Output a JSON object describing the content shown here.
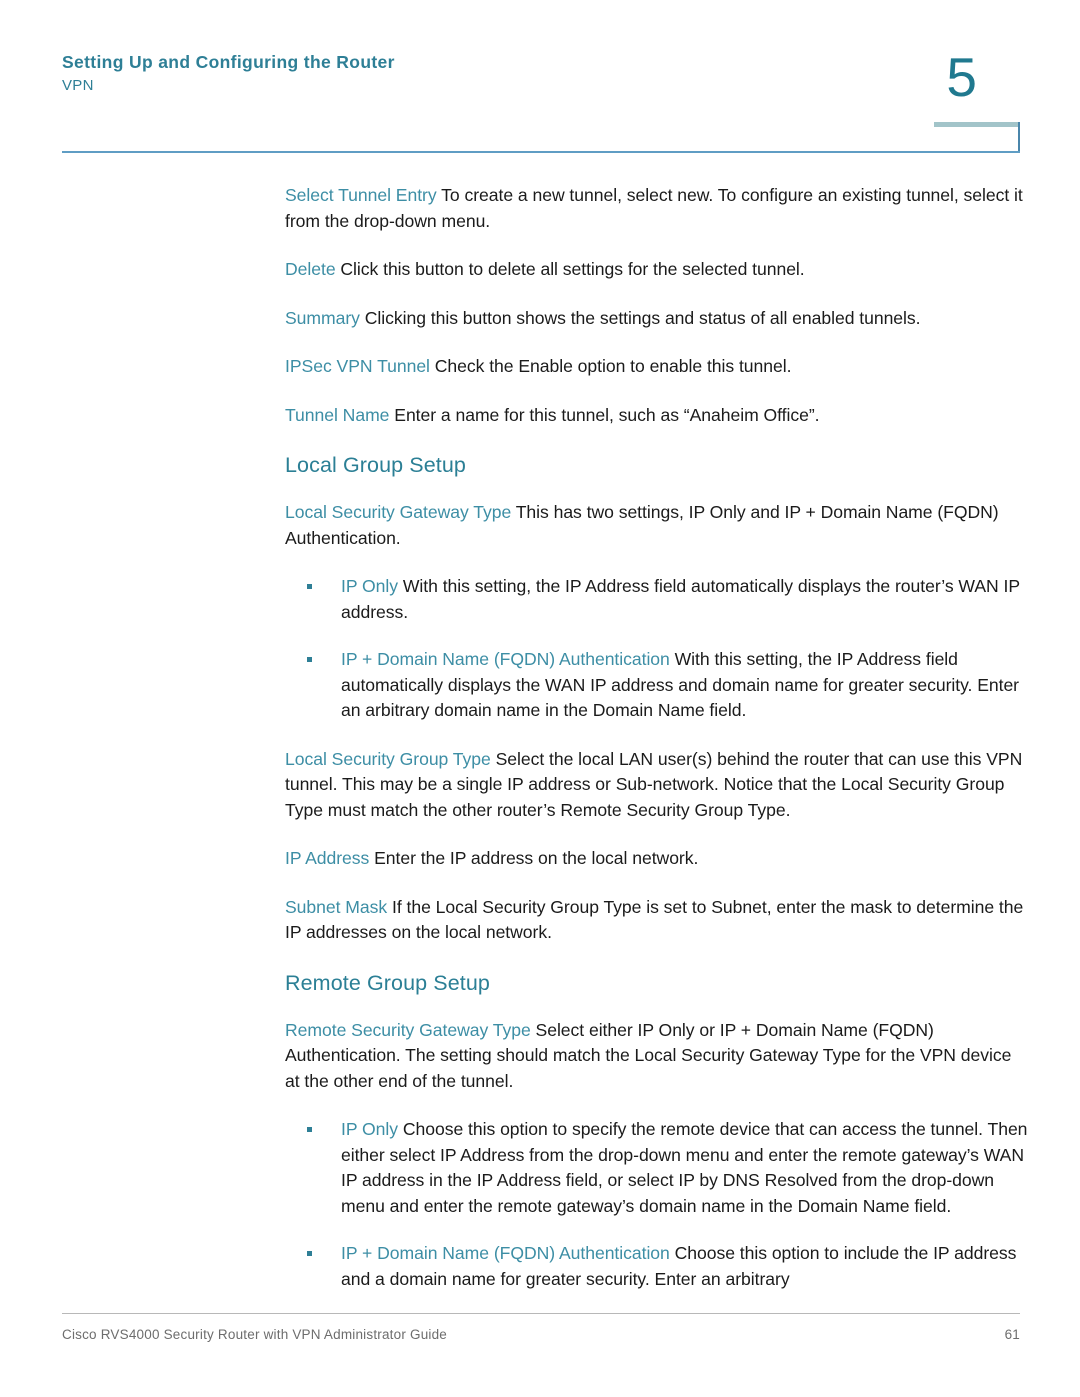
{
  "header": {
    "title": "Setting Up and Configuring the Router",
    "subtitle": "VPN",
    "chapter_number": "5",
    "accent_color": "#2e7f96",
    "rule_color": "#5f9dc4"
  },
  "content": {
    "paragraphs": [
      {
        "term": "Select Tunnel Entry",
        "text": " To create a new tunnel, select new. To configure an existing tunnel, select it from the drop-down menu."
      },
      {
        "term": "Delete",
        "text": " Click this button to delete all settings for the selected tunnel."
      },
      {
        "term": "Summary",
        "text": " Clicking this button shows the settings and status of all enabled tunnels."
      },
      {
        "term": "IPSec VPN Tunnel",
        "text": " Check the Enable option to enable this tunnel."
      },
      {
        "term": "Tunnel Name",
        "text": " Enter a name for this tunnel, such as “Anaheim Office”."
      }
    ],
    "section_local": {
      "heading": "Local Group Setup",
      "gateway_type": {
        "term": "Local Security Gateway Type",
        "text": " This has two settings, IP Only and IP + Domain Name (FQDN) Authentication."
      },
      "bullets": [
        {
          "term": "IP Only",
          "text": " With this setting, the IP Address field automatically displays the router’s WAN IP address."
        },
        {
          "term": "IP + Domain Name (FQDN) Authentication",
          "text": " With this setting, the IP Address field automatically displays the WAN IP address and domain name for greater security. Enter an arbitrary domain name in the Domain Name field."
        }
      ],
      "group_type": {
        "term": "Local Security Group Type",
        "text": " Select the local LAN user(s) behind the router that can use this VPN tunnel. This may be a single IP address or Sub-network. Notice that the Local Security Group Type must match the other router’s Remote Security Group Type."
      },
      "ip_address": {
        "term": "IP Address",
        "text": " Enter the IP address on the local network."
      },
      "subnet_mask": {
        "term": "Subnet Mask",
        "text": " If the Local Security Group Type is set to Subnet, enter the mask to determine the IP addresses on the local network."
      }
    },
    "section_remote": {
      "heading": "Remote Group Setup",
      "gateway_type": {
        "term": "Remote Security Gateway Type",
        "text": " Select either IP Only or IP + Domain Name (FQDN) Authentication. The setting should match the Local Security Gateway Type for the VPN device at the other end of the tunnel."
      },
      "bullets": [
        {
          "term": "IP Only",
          "text": " Choose this option to specify the remote device that can access the tunnel. Then either select IP Address from the drop-down menu and enter the remote gateway’s WAN IP address in the IP Address field, or select IP by DNS Resolved from the drop-down menu and enter the remote gateway’s domain name in the Domain Name field."
        },
        {
          "term": "IP + Domain Name (FQDN) Authentication",
          "text": " Choose this option to include the IP address and a domain name for greater security. Enter an arbitrary"
        }
      ]
    }
  },
  "footer": {
    "guide_title": "Cisco RVS4000 Security Router with VPN Administrator Guide",
    "page_number": "61"
  }
}
